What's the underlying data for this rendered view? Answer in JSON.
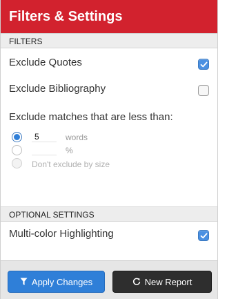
{
  "panel": {
    "title": "Filters & Settings"
  },
  "filters": {
    "section_label": "FILTERS",
    "exclude_quotes": {
      "label": "Exclude Quotes",
      "checked": true
    },
    "exclude_bibliography": {
      "label": "Exclude Bibliography",
      "checked": false
    },
    "exclude_matches_label": "Exclude matches that are less than:",
    "size_options": {
      "words": {
        "value": "5",
        "unit": "words",
        "selected": true
      },
      "percent": {
        "value": "",
        "unit": "%",
        "selected": false
      },
      "none": {
        "label": "Don't exclude by size",
        "selected": false
      }
    }
  },
  "optional": {
    "section_label": "OPTIONAL SETTINGS",
    "multi_color": {
      "label": "Multi-color Highlighting",
      "checked": true
    }
  },
  "footer": {
    "apply_label": "Apply Changes",
    "new_report_label": "New Report"
  },
  "colors": {
    "brand_red": "#d2222e",
    "accent_blue": "#2f7fd8",
    "dark_button": "#2e2e2e"
  }
}
